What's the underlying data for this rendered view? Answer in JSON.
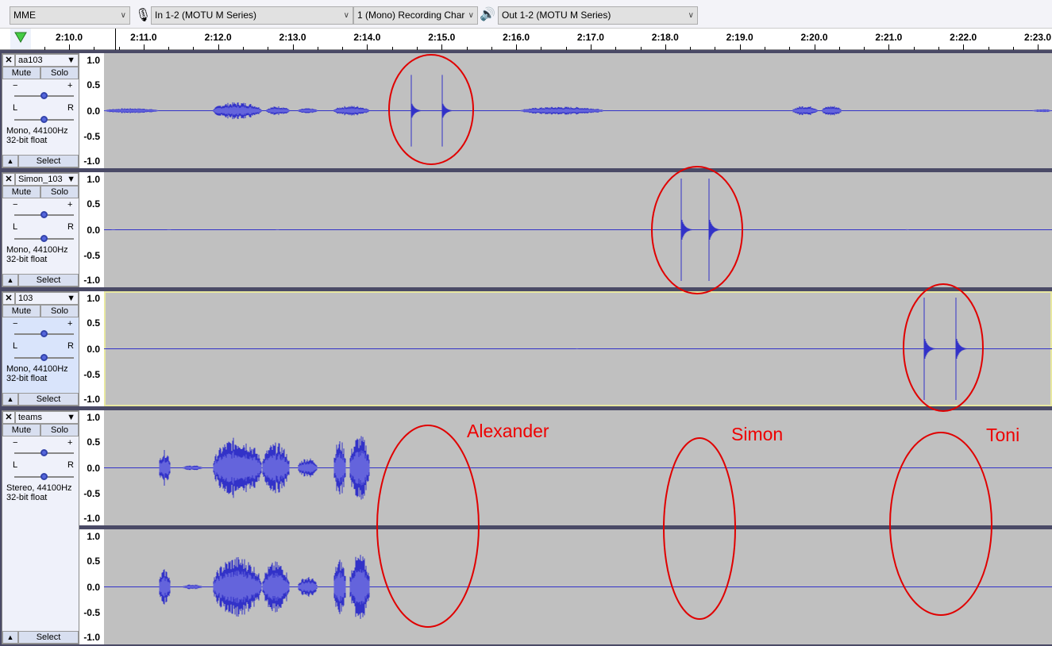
{
  "toolbar": {
    "host": "MME",
    "input_device": "In 1-2 (MOTU M Series)",
    "channels": "1 (Mono) Recording Char",
    "output_device": "Out 1-2 (MOTU M Series)"
  },
  "ruler": {
    "ticks": [
      "2:10.0",
      "2:11.0",
      "2:12.0",
      "2:13.0",
      "2:14.0",
      "2:15.0",
      "2:16.0",
      "2:17.0",
      "2:18.0",
      "2:19.0",
      "2:20.0",
      "2:21.0",
      "2:22.0",
      "2:23.0"
    ]
  },
  "scale": [
    "1.0",
    "0.5",
    "0.0",
    "-0.5",
    "-1.0"
  ],
  "labels": {
    "mute": "Mute",
    "solo": "Solo",
    "select": "Select",
    "gain_minus": "−",
    "gain_plus": "+",
    "pan_l": "L",
    "pan_r": "R"
  },
  "tracks": [
    {
      "name": "aa103",
      "format": "Mono, 44100Hz",
      "depth": "32-bit float"
    },
    {
      "name": "Simon_103",
      "format": "Mono, 44100Hz",
      "depth": "32-bit float"
    },
    {
      "name": "103",
      "format": "Mono, 44100Hz",
      "depth": "32-bit float",
      "selected": true
    },
    {
      "name": "teams",
      "format": "Stereo, 44100Hz",
      "depth": "32-bit float"
    }
  ],
  "annotations": [
    "Alexander",
    "Simon",
    "Toni"
  ],
  "colors": {
    "waveform": "#3232c8",
    "waveform_rms": "#6464dc",
    "annotation": "#e00000",
    "selected_border": "#e8e8a0"
  }
}
